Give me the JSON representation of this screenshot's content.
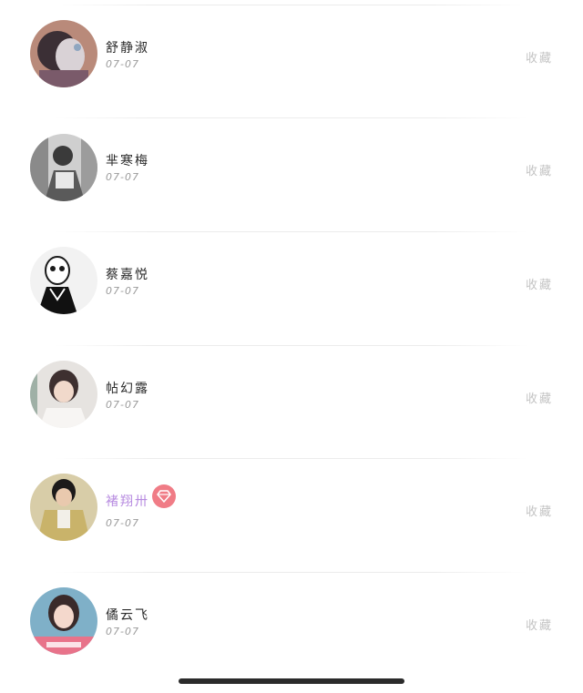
{
  "items": [
    {
      "name": "舒静淑",
      "date": "07-07",
      "action": "收藏",
      "vip": false,
      "avatar_icon": "avatar-icon"
    },
    {
      "name": "芈寒梅",
      "date": "07-07",
      "action": "收藏",
      "vip": false,
      "avatar_icon": "avatar-icon"
    },
    {
      "name": "蔡嘉悦",
      "date": "07-07",
      "action": "收藏",
      "vip": false,
      "avatar_icon": "avatar-icon"
    },
    {
      "name": "帖幻露",
      "date": "07-07",
      "action": "收藏",
      "vip": false,
      "avatar_icon": "avatar-icon"
    },
    {
      "name": "褚翔卅",
      "date": "07-07",
      "action": "收藏",
      "vip": true,
      "avatar_icon": "avatar-icon"
    },
    {
      "name": "僪云飞",
      "date": "07-07",
      "action": "收藏",
      "vip": false,
      "avatar_icon": "avatar-icon"
    }
  ],
  "colors": {
    "vip_name": "#b78be0",
    "vip_badge": "#f07c86"
  },
  "icons": {
    "vip_badge": "diamond-icon"
  }
}
